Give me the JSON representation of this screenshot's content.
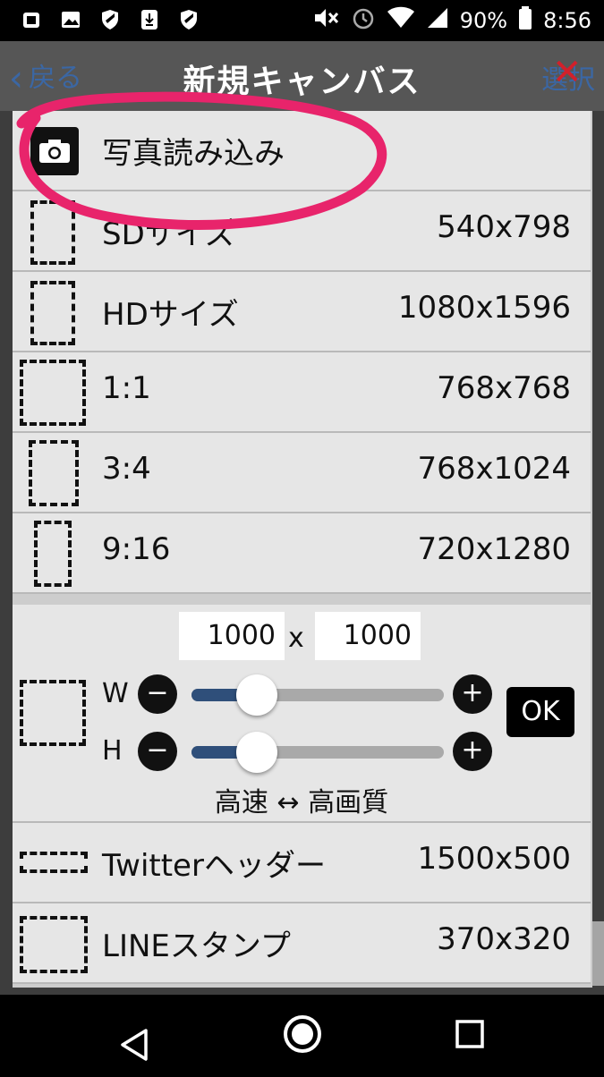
{
  "status_bar": {
    "battery": "90%",
    "time": "8:56"
  },
  "app_bar": {
    "back_label": "戻る",
    "select_label": "選択"
  },
  "dialog": {
    "title": "新規キャンバス",
    "photo_import": "写真読み込み",
    "presets": [
      {
        "label": "SDサイズ",
        "size": "540x798"
      },
      {
        "label": "HDサイズ",
        "size": "1080x1596"
      },
      {
        "label": "1:1",
        "size": "768x768"
      },
      {
        "label": "3:4",
        "size": "768x1024"
      },
      {
        "label": "9:16",
        "size": "720x1280"
      }
    ],
    "custom": {
      "width_value": "1000",
      "height_value": "1000",
      "separator": "x",
      "w_label": "W",
      "h_label": "H",
      "minus": "−",
      "plus": "+",
      "ok_label": "OK",
      "w_slider_level": 0.26,
      "h_slider_level": 0.26,
      "quality_caption": "高速 ↔ 高画質"
    },
    "extra_presets": [
      {
        "label": "Twitterヘッダー",
        "size": "1500x500"
      },
      {
        "label": "LINEスタンプ",
        "size": "370x320"
      }
    ]
  },
  "colors": {
    "annotation": "#e8246b",
    "accent": "#3b67a4",
    "slider_fill": "#2f4f7a"
  }
}
